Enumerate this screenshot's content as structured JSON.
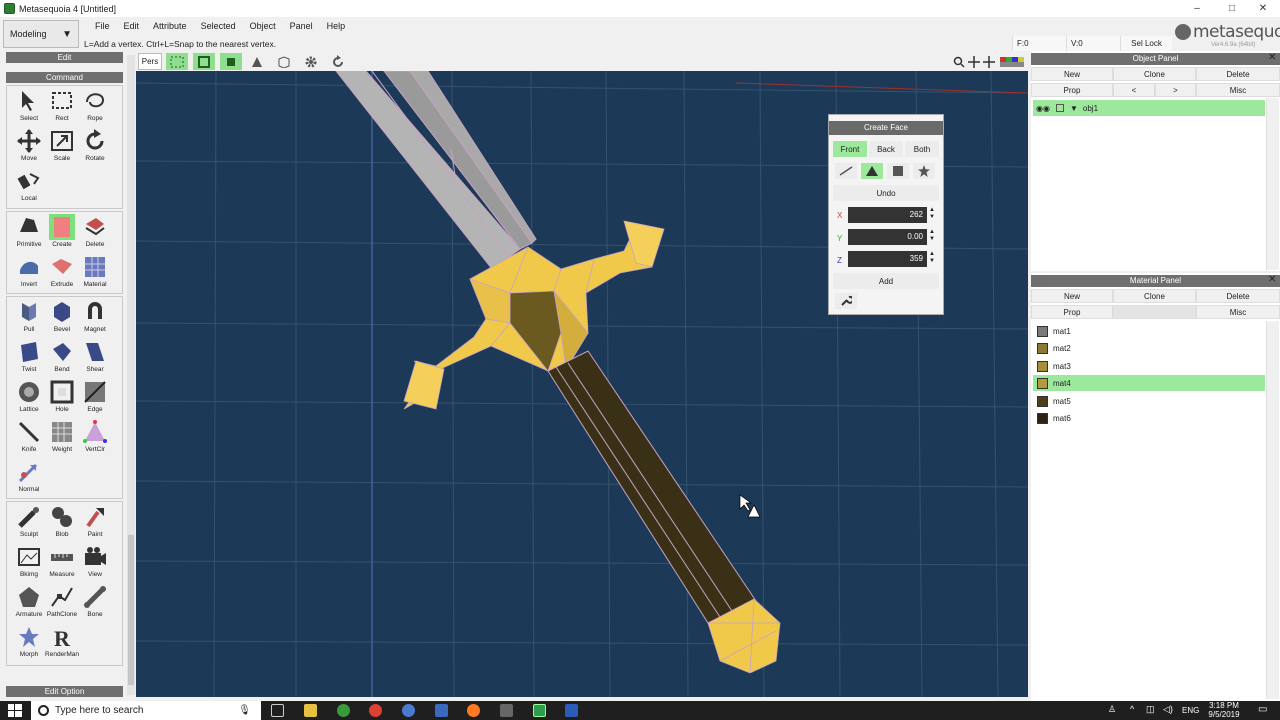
{
  "window": {
    "title": "Metasequoia 4 [Untitled]",
    "controls": [
      "–",
      "□",
      "✕"
    ]
  },
  "mode": {
    "value": "Modeling"
  },
  "menu": [
    "File",
    "Edit",
    "Attribute",
    "Selected",
    "Object",
    "Panel",
    "Help"
  ],
  "hint": "L=Add a vertex.  Ctrl+L=Snap to the nearest vertex.",
  "logo": {
    "text": "metasequoia",
    "version": "Ver4.6.9a (64bit)",
    "num": "4"
  },
  "status": {
    "face": "F:0",
    "vertex": "V:0",
    "sel_lock": "Sel Lock"
  },
  "left": {
    "edit_header": "Edit",
    "command_header": "Command",
    "edit_option": "Edit Option",
    "groups": [
      [
        {
          "label": "Select",
          "icon": "select-arrow-icon"
        },
        {
          "label": "Rect",
          "icon": "rect-select-icon"
        },
        {
          "label": "Rope",
          "icon": "rope-select-icon"
        },
        {
          "label": "Move",
          "icon": "move-icon"
        },
        {
          "label": "Scale",
          "icon": "scale-icon"
        },
        {
          "label": "Rotate",
          "icon": "rotate-icon"
        },
        {
          "label": "Local",
          "icon": "local-icon"
        }
      ],
      [
        {
          "label": "Primitive",
          "icon": "primitive-icon"
        },
        {
          "label": "Create",
          "icon": "create-face-icon"
        },
        {
          "label": "Delete",
          "icon": "delete-icon"
        },
        {
          "label": "Invert",
          "icon": "invert-icon"
        },
        {
          "label": "Extrude",
          "icon": "extrude-icon"
        },
        {
          "label": "Material",
          "icon": "material-icon"
        }
      ],
      [
        {
          "label": "Pull",
          "icon": "pull-icon"
        },
        {
          "label": "Bevel",
          "icon": "bevel-icon"
        },
        {
          "label": "Magnet",
          "icon": "magnet-icon"
        },
        {
          "label": "Twist",
          "icon": "twist-icon"
        },
        {
          "label": "Bend",
          "icon": "bend-icon"
        },
        {
          "label": "Shear",
          "icon": "shear-icon"
        },
        {
          "label": "Lattice",
          "icon": "lattice-icon"
        },
        {
          "label": "Hole",
          "icon": "hole-icon"
        },
        {
          "label": "Edge",
          "icon": "edge-icon"
        },
        {
          "label": "Knife",
          "icon": "knife-icon"
        },
        {
          "label": "Weight",
          "icon": "weight-icon"
        },
        {
          "label": "VertClr",
          "icon": "vertex-color-icon"
        },
        {
          "label": "Normal",
          "icon": "normal-icon"
        }
      ],
      [
        {
          "label": "Sculpt",
          "icon": "sculpt-icon"
        },
        {
          "label": "Blob",
          "icon": "blob-icon"
        },
        {
          "label": "Paint",
          "icon": "paint-icon"
        },
        {
          "label": "Bkimg",
          "icon": "background-image-icon"
        },
        {
          "label": "Measure",
          "icon": "measure-icon"
        },
        {
          "label": "View",
          "icon": "camera-icon"
        },
        {
          "label": "Armature",
          "icon": "armature-icon"
        },
        {
          "label": "PathClone",
          "icon": "pathclone-icon"
        },
        {
          "label": "Bone",
          "icon": "bone-icon"
        },
        {
          "label": "Morph",
          "icon": "morph-icon"
        },
        {
          "label": "RenderMan",
          "icon": "renderman-icon"
        }
      ]
    ]
  },
  "viewport": {
    "projection": "Pers"
  },
  "create_face": {
    "title": "Create Face",
    "tabs": [
      "Front",
      "Back",
      "Both"
    ],
    "selected_tab": "Front",
    "undo": "Undo",
    "x_label": "X",
    "x": "262",
    "y_label": "Y",
    "y": "0.00",
    "z_label": "Z",
    "z": "359",
    "add": "Add"
  },
  "object_panel": {
    "title": "Object Panel",
    "buttons": [
      "New",
      "Clone",
      "Delete",
      "Prop",
      "<",
      ">",
      "Misc"
    ],
    "objects": [
      {
        "name": "obj1"
      }
    ]
  },
  "material_panel": {
    "title": "Material Panel",
    "buttons": [
      "New",
      "Clone",
      "Delete",
      "Prop",
      "Misc"
    ],
    "materials": [
      {
        "name": "mat1",
        "color": "#7a7a7a"
      },
      {
        "name": "mat2",
        "color": "#8a7a36"
      },
      {
        "name": "mat3",
        "color": "#a58f3c"
      },
      {
        "name": "mat4",
        "color": "#b39a3c"
      },
      {
        "name": "mat5",
        "color": "#4c3f1c"
      },
      {
        "name": "mat6",
        "color": "#2a2412"
      }
    ],
    "selected": "mat4"
  },
  "taskbar": {
    "search_placeholder": "Type here to search",
    "language": "ENG",
    "time": "3:18 PM",
    "date": "9/5/2019"
  },
  "colors": {
    "viewport_bg": "#1c3a57",
    "selection_green": "#9ce89c",
    "gold": "#f0c94b",
    "dark_gold": "#3a3016"
  }
}
